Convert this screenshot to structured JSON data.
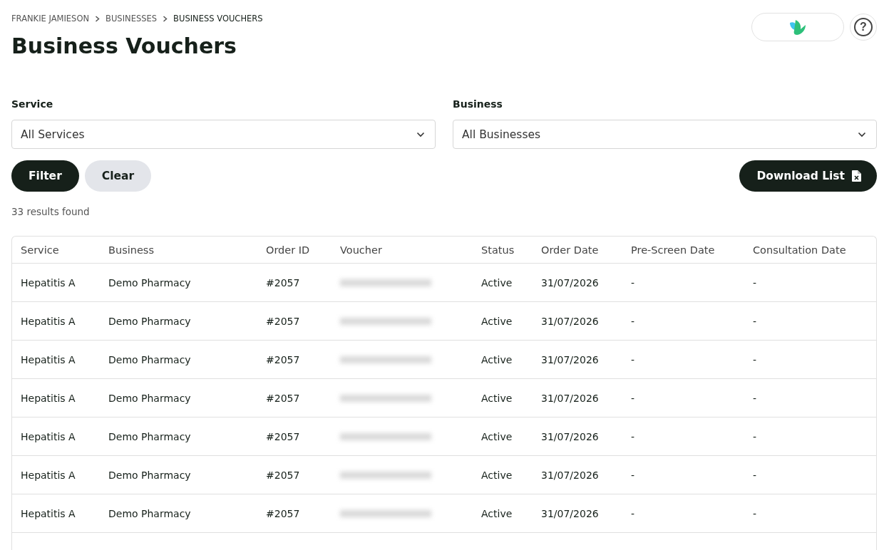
{
  "breadcrumb": [
    {
      "label": "FRANKIE JAMIESON",
      "current": false
    },
    {
      "label": "BUSINESSES",
      "current": false
    },
    {
      "label": "BUSINESS VOUCHERS",
      "current": true
    }
  ],
  "header": {
    "help_label": "?"
  },
  "title": "Business Vouchers",
  "filters": [
    {
      "label": "Service",
      "value": "All Services"
    },
    {
      "label": "Business",
      "value": "All Businesses"
    }
  ],
  "buttons": [
    {
      "label": "Filter",
      "kind": "primary"
    },
    {
      "label": "Clear",
      "kind": "secondary"
    }
  ],
  "download_button": {
    "label": "Download List"
  },
  "results": "33 results found",
  "table": {
    "columns": [
      "Service",
      "Business",
      "Order ID",
      "Voucher",
      "Status",
      "Order Date",
      "Pre-Screen Date",
      "Consultation Date"
    ],
    "rows": [
      {
        "service": "Hepatitis A",
        "business": "Demo Pharmacy",
        "order_id": "#2057",
        "voucher": {
          "kind": "blurred"
        },
        "status": "Active",
        "order_date": "31/07/2026",
        "pre_screen_date": "-",
        "consultation_date": "-"
      },
      {
        "service": "Hepatitis A",
        "business": "Demo Pharmacy",
        "order_id": "#2057",
        "voucher": {
          "kind": "blurred"
        },
        "status": "Active",
        "order_date": "31/07/2026",
        "pre_screen_date": "-",
        "consultation_date": "-"
      },
      {
        "service": "Hepatitis A",
        "business": "Demo Pharmacy",
        "order_id": "#2057",
        "voucher": {
          "kind": "blurred"
        },
        "status": "Active",
        "order_date": "31/07/2026",
        "pre_screen_date": "-",
        "consultation_date": "-"
      },
      {
        "service": "Hepatitis A",
        "business": "Demo Pharmacy",
        "order_id": "#2057",
        "voucher": {
          "kind": "blurred"
        },
        "status": "Active",
        "order_date": "31/07/2026",
        "pre_screen_date": "-",
        "consultation_date": "-"
      },
      {
        "service": "Hepatitis A",
        "business": "Demo Pharmacy",
        "order_id": "#2057",
        "voucher": {
          "kind": "blurred"
        },
        "status": "Active",
        "order_date": "31/07/2026",
        "pre_screen_date": "-",
        "consultation_date": "-"
      },
      {
        "service": "Hepatitis A",
        "business": "Demo Pharmacy",
        "order_id": "#2057",
        "voucher": {
          "kind": "blurred"
        },
        "status": "Active",
        "order_date": "31/07/2026",
        "pre_screen_date": "-",
        "consultation_date": "-"
      },
      {
        "service": "Hepatitis A",
        "business": "Demo Pharmacy",
        "order_id": "#2057",
        "voucher": {
          "kind": "blurred"
        },
        "status": "Active",
        "order_date": "31/07/2026",
        "pre_screen_date": "-",
        "consultation_date": "-"
      }
    ]
  }
}
